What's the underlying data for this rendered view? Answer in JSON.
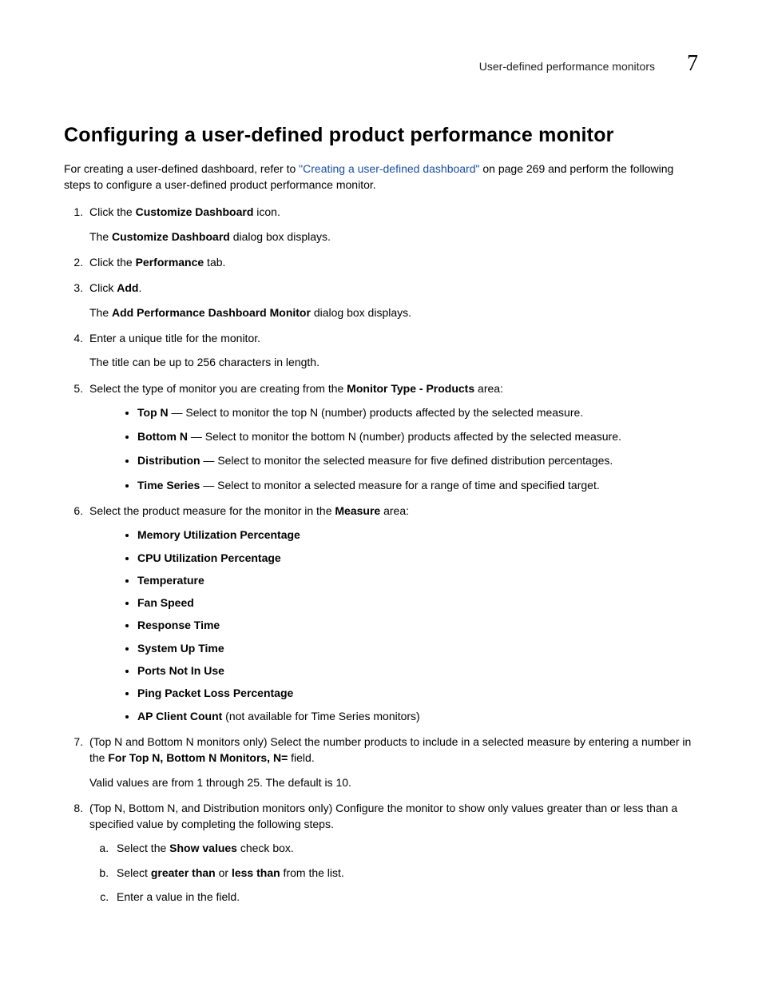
{
  "header": {
    "section_label": "User-defined performance monitors",
    "chapter_number": "7"
  },
  "title": "Configuring a user-defined product performance monitor",
  "intro": {
    "pre_link": "For creating a user-defined dashboard, refer to ",
    "link_text": "\"Creating a user-defined dashboard\"",
    "post_link": " on page 269 and perform the following steps to configure a user-defined product performance monitor."
  },
  "steps": {
    "s1": {
      "pre": "Click the ",
      "bold": "Customize Dashboard",
      "post": " icon.",
      "note_pre": "The ",
      "note_bold": "Customize Dashboard",
      "note_post": " dialog box displays."
    },
    "s2": {
      "pre": "Click the ",
      "bold": "Performance",
      "post": " tab."
    },
    "s3": {
      "pre": "Click ",
      "bold": "Add",
      "post": ".",
      "note_pre": "The ",
      "note_bold": "Add Performance Dashboard Monitor",
      "note_post": " dialog box displays."
    },
    "s4": {
      "text": "Enter a unique title for the monitor.",
      "note": "The title can be up to 256 characters in length."
    },
    "s5": {
      "pre": "Select the type of monitor you are creating from the ",
      "bold": "Monitor Type - Products",
      "post": " area:",
      "items": {
        "topn": {
          "name": "Top N",
          "desc": " — Select to monitor the top N (number) products affected by the selected measure."
        },
        "botn": {
          "name": "Bottom N",
          "desc": " — Select to monitor the bottom N (number) products affected by the selected measure."
        },
        "dist": {
          "name": "Distribution",
          "desc": " — Select to monitor the selected measure for five defined distribution percentages."
        },
        "ts": {
          "name": "Time Series",
          "desc": " — Select to monitor a selected measure for a range of time and specified target."
        }
      }
    },
    "s6": {
      "pre": "Select the product measure for the monitor in the ",
      "bold": "Measure",
      "post": " area:",
      "measures": {
        "m1": "Memory Utilization Percentage",
        "m2": "CPU Utilization Percentage",
        "m3": "Temperature",
        "m4": "Fan Speed",
        "m5": "Response Time",
        "m6": "System Up Time",
        "m7": "Ports Not In Use",
        "m8": "Ping Packet Loss Percentage",
        "m9_bold": "AP Client Count",
        "m9_rest": " (not available for Time Series monitors)"
      }
    },
    "s7": {
      "pre": "(Top N and Bottom N monitors only) Select the number products to include in a selected measure by entering a number in the ",
      "bold": "For Top N, Bottom N Monitors, N=",
      "post": " field.",
      "note": "Valid values are from 1 through 25. The default is 10."
    },
    "s8": {
      "text": "(Top N, Bottom N, and Distribution monitors only) Configure the monitor to show only values greater than or less than a specified value by completing the following steps.",
      "a": {
        "pre": "Select the ",
        "bold": "Show values",
        "post": " check box."
      },
      "b": {
        "pre": "Select ",
        "b1": "greater than",
        "mid": " or ",
        "b2": "less than",
        "post": " from the list."
      },
      "c": "Enter a value in the field."
    }
  }
}
